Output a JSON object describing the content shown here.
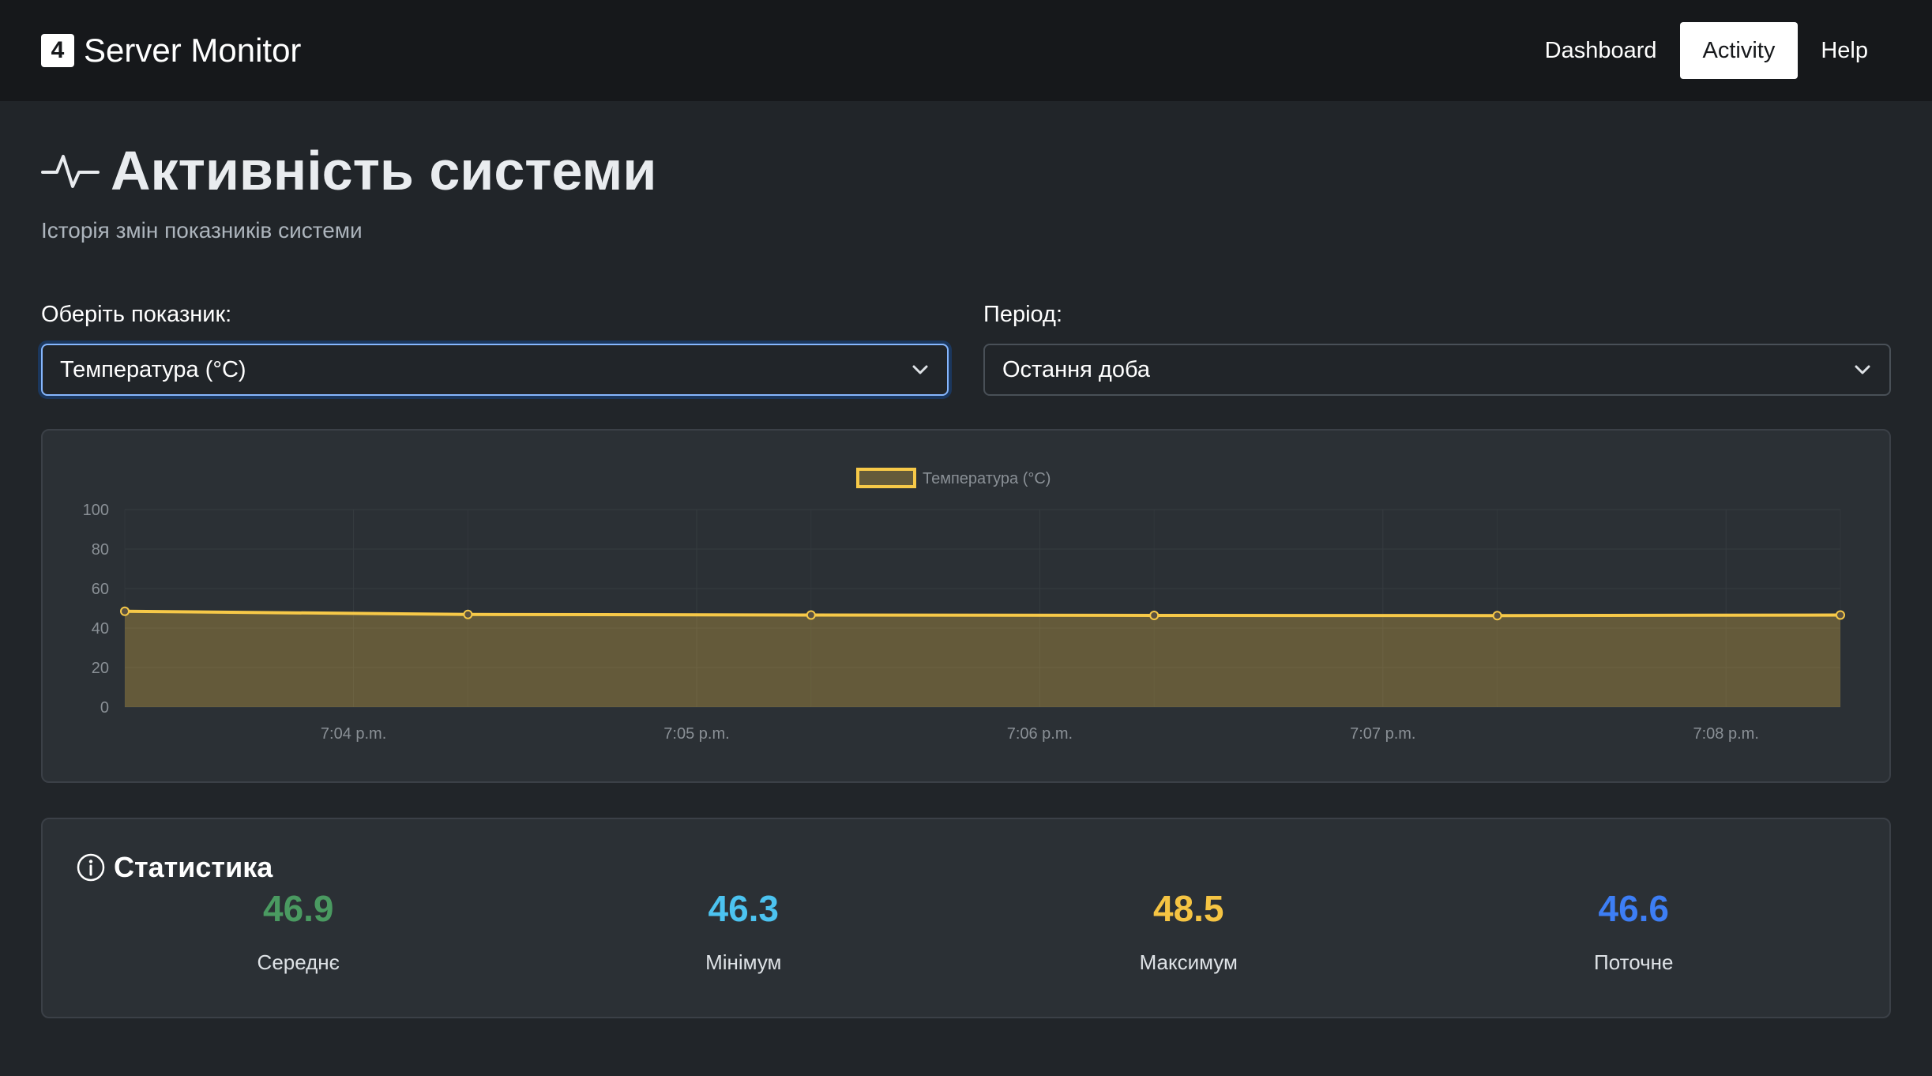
{
  "navbar": {
    "brand_icon": "4",
    "brand_title": "Server Monitor",
    "items": [
      {
        "label": "Dashboard",
        "active": false
      },
      {
        "label": "Activity",
        "active": true
      },
      {
        "label": "Help",
        "active": false
      }
    ]
  },
  "header": {
    "icon": "activity-pulse-icon",
    "title": "Активність системи",
    "subtitle": "Історія змін показників системи"
  },
  "filters": {
    "metric": {
      "label": "Оберіть показник:",
      "value": "Температура (°C)"
    },
    "period": {
      "label": "Період:",
      "value": "Остання доба"
    }
  },
  "chart_data": {
    "type": "area",
    "series": [
      {
        "name": "Температура (°C)",
        "values": [
          48.5,
          46.9,
          46.6,
          46.4,
          46.3,
          46.6
        ],
        "color": "#f7c948"
      }
    ],
    "x": [
      "7:03:20 p.m.",
      "7:04:20 p.m.",
      "7:05:20 p.m.",
      "7:06:20 p.m.",
      "7:07:20 p.m.",
      "7:08:20 p.m."
    ],
    "x_tick_labels": [
      "7:04 p.m.",
      "7:05 p.m.",
      "7:06 p.m.",
      "7:07 p.m.",
      "7:08 p.m."
    ],
    "y_ticks": [
      "100",
      "80",
      "60",
      "40",
      "20",
      "0"
    ],
    "ylim": [
      0,
      100
    ],
    "grid": true,
    "legend": "top-center"
  },
  "stats": {
    "icon": "info-circle-icon",
    "title": "Статистика",
    "items": [
      {
        "value": "46.9",
        "label": "Середнє",
        "color": "#4a9a61"
      },
      {
        "value": "46.3",
        "label": "Мінімум",
        "color": "#4cc3f0"
      },
      {
        "value": "48.5",
        "label": "Максимум",
        "color": "#f5c443"
      },
      {
        "value": "46.6",
        "label": "Поточне",
        "color": "#3d7ef5"
      }
    ]
  }
}
